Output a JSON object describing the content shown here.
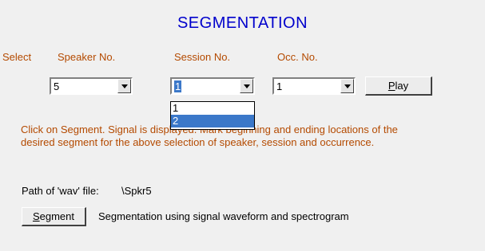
{
  "title": "SEGMENTATION",
  "labels": {
    "select": "Select",
    "speaker": "Speaker No.",
    "session": "Session No.",
    "occurrence": "Occ. No."
  },
  "speaker_combo": {
    "value": "5"
  },
  "session_combo": {
    "value": "1",
    "options": [
      "1",
      "2"
    ],
    "highlighted": "2"
  },
  "occurrence_combo": {
    "value": "1"
  },
  "play_button": {
    "first": "P",
    "rest": "lay"
  },
  "instruction": {
    "line1": "Click on Segment. Signal is displayed. Mark beginning and ending locations of the",
    "line2": "desired segment for the above selection of speaker, session and occurrence."
  },
  "path": {
    "label": "Path of 'wav' file:",
    "value": "\\Spkr5"
  },
  "segment_button": {
    "first": "S",
    "rest": "egment"
  },
  "segment_description": "Segmentation using signal waveform and spectrogram",
  "colors": {
    "title": "#0000cc",
    "label": "#b44a00",
    "highlight": "#3b78c9"
  }
}
